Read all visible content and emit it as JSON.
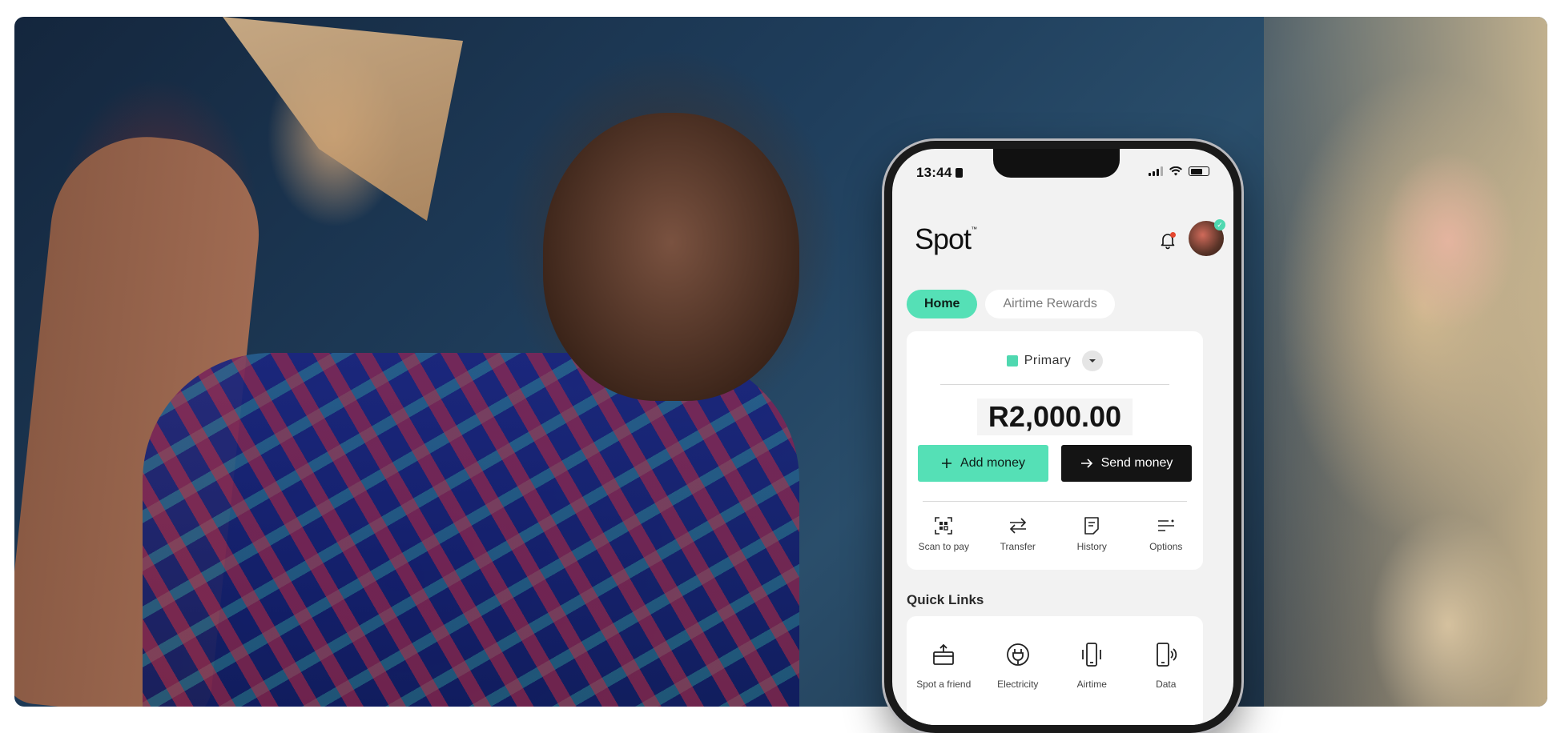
{
  "status_bar": {
    "time": "13:44"
  },
  "app": {
    "logo": "Spot",
    "tabs": [
      {
        "label": "Home",
        "active": true
      },
      {
        "label": "Airtime Rewards",
        "active": false
      }
    ],
    "account": {
      "name": "Primary",
      "balance": "R2,000.00"
    },
    "buttons": {
      "add_money": "Add money",
      "send_money": "Send money"
    },
    "quick_actions": [
      {
        "label": "Scan to pay",
        "icon": "scan-icon"
      },
      {
        "label": "Transfer",
        "icon": "transfer-icon"
      },
      {
        "label": "History",
        "icon": "history-icon"
      },
      {
        "label": "Options",
        "icon": "options-icon"
      }
    ],
    "quick_links_title": "Quick Links",
    "quick_links": [
      {
        "label": "Spot a friend",
        "icon": "gift-icon"
      },
      {
        "label": "Electricity",
        "icon": "plug-icon"
      },
      {
        "label": "Airtime",
        "icon": "phone-vibrate-icon"
      },
      {
        "label": "Data",
        "icon": "phone-signal-icon"
      }
    ]
  },
  "colors": {
    "accent": "#55e0b6",
    "dark": "#141414",
    "notification": "#e5472f"
  }
}
